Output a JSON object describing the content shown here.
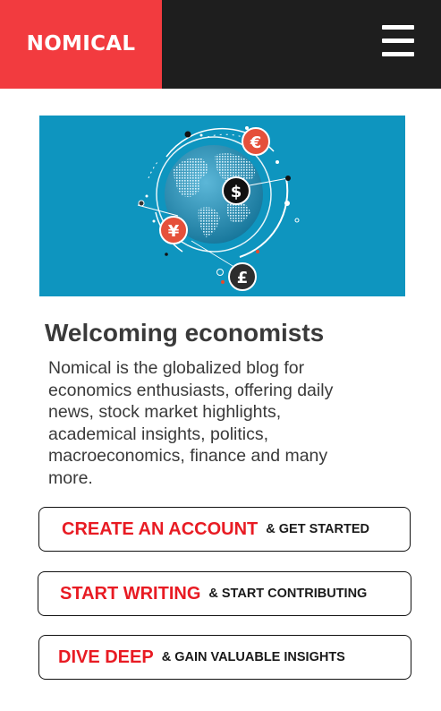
{
  "header": {
    "brand": "NOMICAL",
    "menu_icon": "hamburger-menu-icon"
  },
  "hero": {
    "image": "globe-currency-illustration",
    "symbols": {
      "euro": "€",
      "dollar": "$",
      "yen": "¥",
      "pound": "£"
    }
  },
  "main": {
    "title": "Welcoming economists",
    "description": "Nomical is the globalized blog for economics enthusiasts, offering daily news, stock market highlights, academical insights, politics, macroeconomics, finance and many more."
  },
  "cta": [
    {
      "main": "CREATE AN ACCOUNT",
      "sub": "& GET STARTED"
    },
    {
      "main": "START WRITING",
      "sub": "& START CONTRIBUTING"
    },
    {
      "main": "DIVE DEEP",
      "sub": "& GAIN VALUABLE INSIGHTS"
    }
  ],
  "colors": {
    "brand_red": "#f23b3f",
    "header_dark": "#1e1e1e",
    "hero_blue": "#0e95bf",
    "cta_red": "#e81b23"
  }
}
